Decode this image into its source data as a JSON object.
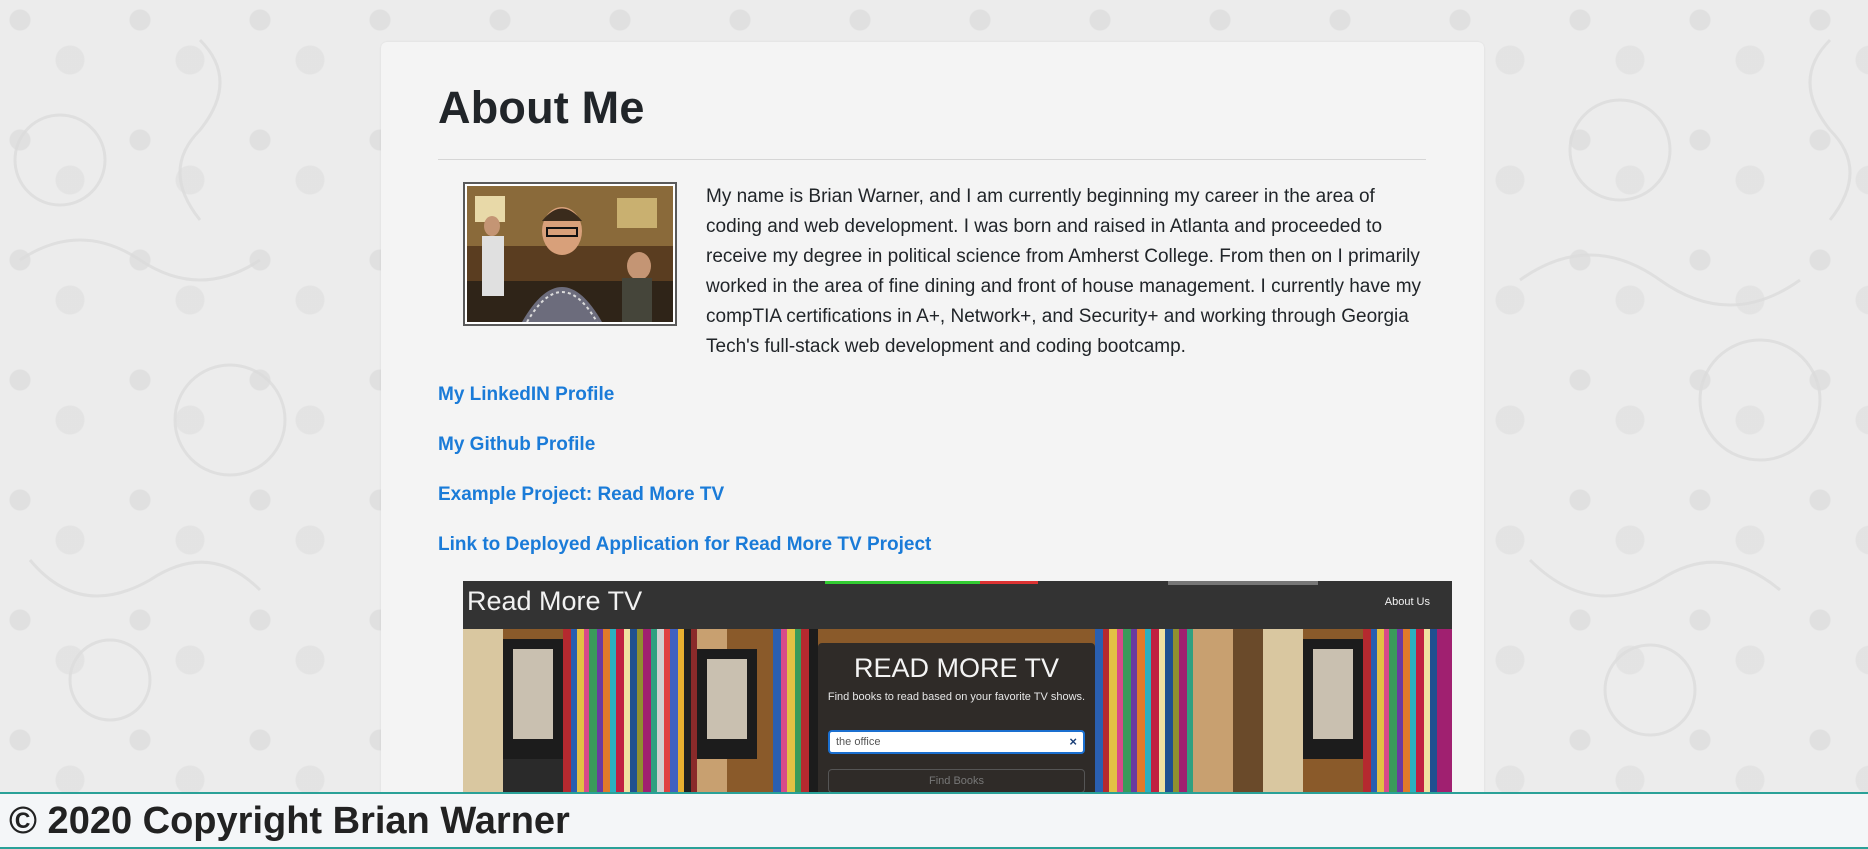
{
  "about": {
    "title": "About Me",
    "bio": "My name is Brian Warner, and I am currently beginning my career in the area of coding and web development. I was born and raised in Atlanta and proceeded to receive my degree in political science from Amherst College. From then on I primarily worked in the area of fine dining and front of house management. I currently have my compTIA certifications in A+, Network+, and Security+ and working through Georgia Tech's full-stack web development and coding bootcamp."
  },
  "links": {
    "linkedin": "My LinkedIN Profile",
    "github": "My Github Profile",
    "project": "Example Project: Read More TV",
    "deployed": "Link to Deployed Application for Read More TV Project"
  },
  "project_screenshot": {
    "brand": "Read More TV",
    "nav_link": "About Us",
    "hero_title": "READ MORE TV",
    "hero_subtitle": "Find books to read based on your favorite TV shows.",
    "search_value": "the office",
    "search_clear": "×",
    "find_button": "Find Books"
  },
  "footer": {
    "copyright": "© 2020 Copyright Brian Warner"
  },
  "colors": {
    "link": "#1a7bd8",
    "footer_border": "#2aa198",
    "card_bg": "#f4f4f4"
  }
}
